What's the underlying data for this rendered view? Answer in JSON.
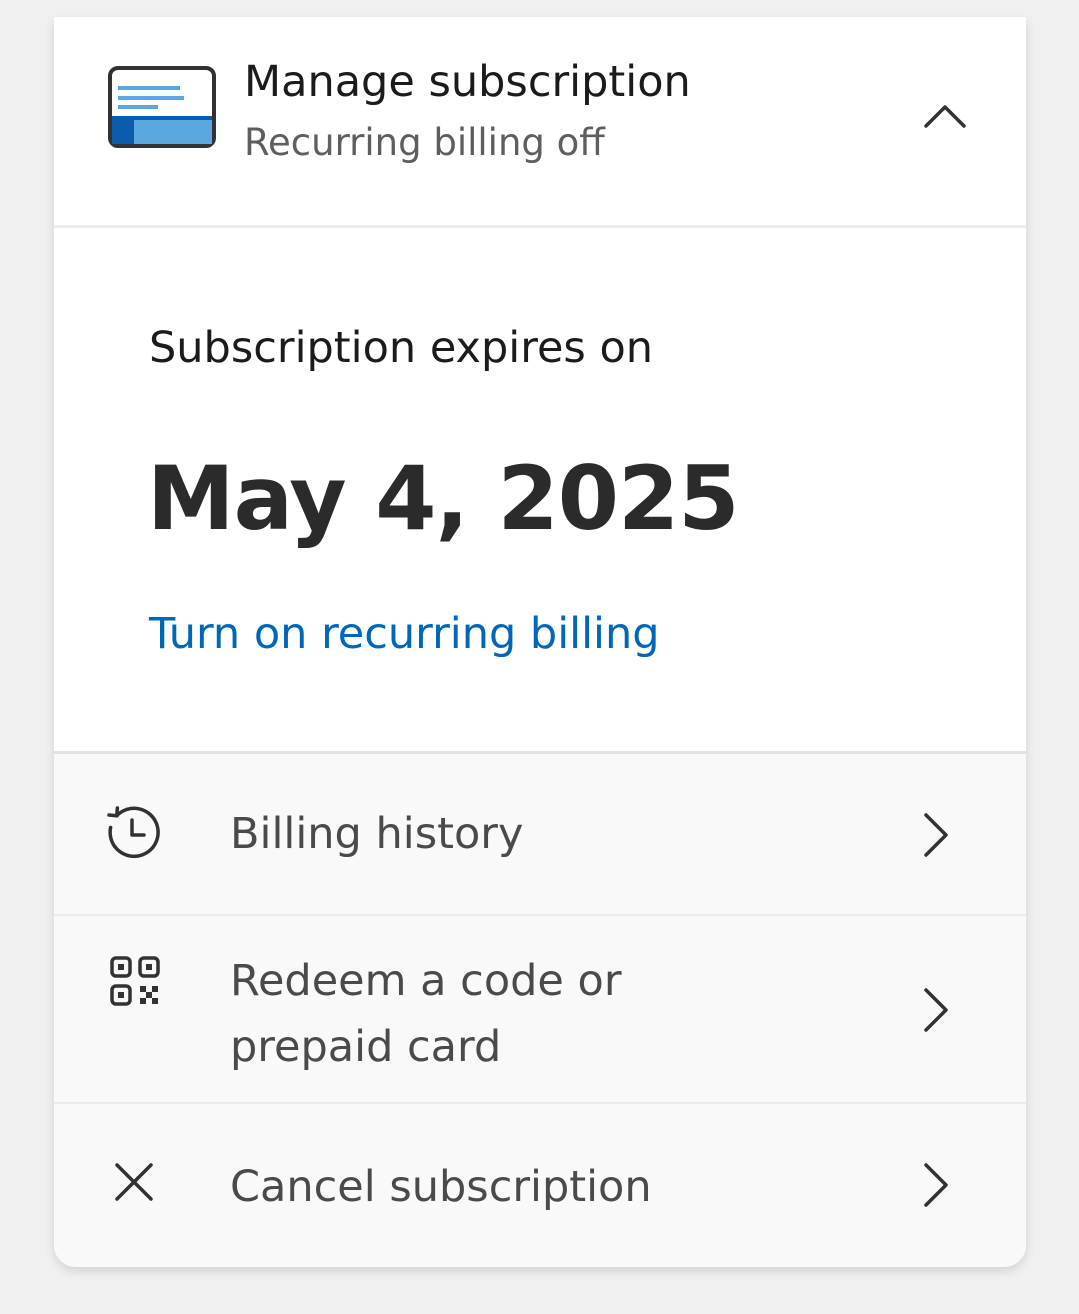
{
  "header": {
    "title": "Manage subscription",
    "subtitle": "Recurring billing off",
    "icon": "subscription-card-icon",
    "toggle_icon": "chevron-up-icon"
  },
  "subscription": {
    "expires_label": "Subscription expires on",
    "expires_date": "May 4, 2025",
    "recurring_link": "Turn on recurring billing"
  },
  "menu": {
    "items": [
      {
        "label": "Billing history",
        "icon": "history-icon"
      },
      {
        "label": "Redeem a code or prepaid card",
        "icon": "qr-code-icon"
      },
      {
        "label": "Cancel subscription",
        "icon": "close-icon"
      }
    ]
  },
  "colors": {
    "accent": "#0067b8",
    "card_icon_light": "#5aa7e0",
    "card_icon_dark": "#0b5cad"
  }
}
